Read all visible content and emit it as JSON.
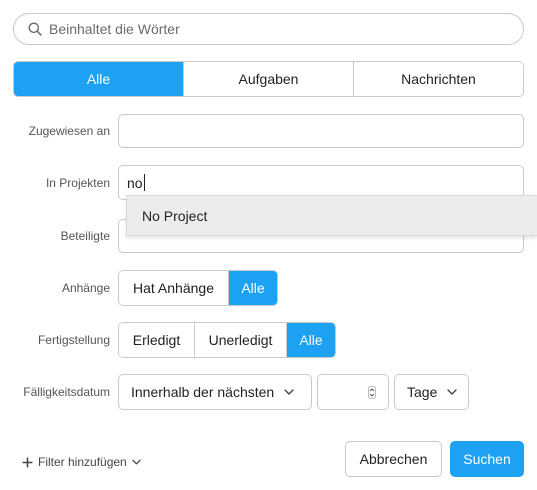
{
  "search": {
    "placeholder": "Beinhaltet die Wörter",
    "value": ""
  },
  "type_tabs": [
    {
      "label": "Alle",
      "active": true
    },
    {
      "label": "Aufgaben",
      "active": false
    },
    {
      "label": "Nachrichten",
      "active": false
    }
  ],
  "assigned": {
    "label": "Zugewiesen an",
    "value": ""
  },
  "projects": {
    "label": "In Projekten",
    "value": "no"
  },
  "project_suggestion": {
    "label": "No Project"
  },
  "participants": {
    "label": "Beteiligte"
  },
  "attachments": {
    "label": "Anhänge",
    "options": [
      {
        "label": "Hat Anhänge",
        "active": false
      },
      {
        "label": "Alle",
        "active": true
      }
    ]
  },
  "completion": {
    "label": "Fertigstellung",
    "options": [
      {
        "label": "Erledigt",
        "active": false
      },
      {
        "label": "Unerledigt",
        "active": false
      },
      {
        "label": "Alle",
        "active": true
      }
    ]
  },
  "due_date": {
    "label": "Fälligkeitsdatum",
    "range_select": "Innerhalb der nächsten",
    "amount": "",
    "unit_select": "Tage"
  },
  "footer": {
    "add_filter": "Filter hinzufügen",
    "cancel": "Abbrechen",
    "submit": "Suchen"
  },
  "colors": {
    "accent": "#1da1f2",
    "border": "#c9c9c9"
  },
  "icons": {
    "search": "search-icon",
    "chevron": "chevron-down-icon",
    "plus": "plus-icon",
    "stepper": "stepper-icon"
  }
}
